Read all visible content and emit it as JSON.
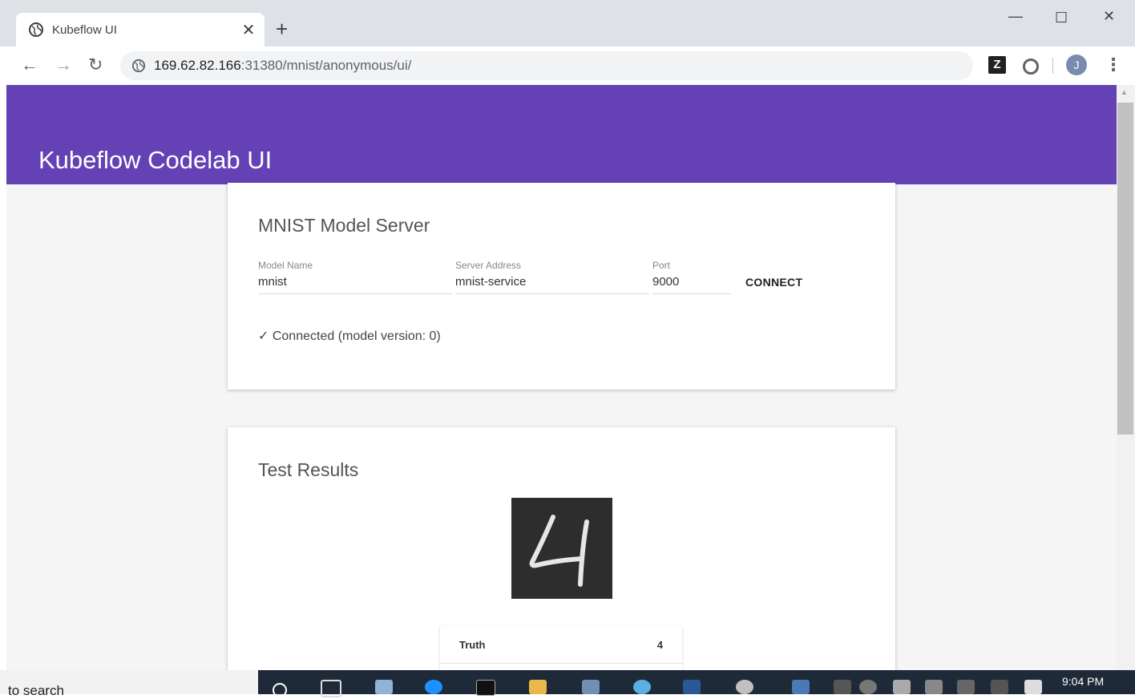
{
  "browser": {
    "tab_title": "Kubeflow UI",
    "tab_close": "✕",
    "new_tab": "+",
    "url_host": "169.62.82.166",
    "url_rest": ":31380/mnist/anonymous/ui/",
    "back": "←",
    "forward": "→",
    "reload": "↻",
    "extension_z": "Z",
    "profile_initial": "J",
    "menu": "⋮",
    "minimize": "—",
    "maximize": "☐",
    "close": "✕"
  },
  "app": {
    "title": "Kubeflow Codelab UI",
    "accent_color": "#6441b5"
  },
  "server_card": {
    "title": "MNIST Model Server",
    "model_name_label": "Model Name",
    "model_name_value": "mnist",
    "server_address_label": "Server Address",
    "server_address_value": "mnist-service",
    "port_label": "Port",
    "port_value": "9000",
    "connect_label": "CONNECT",
    "status": "✓ Connected (model version: 0)"
  },
  "results_card": {
    "title": "Test Results",
    "digit_image": "handwritten digit 4",
    "rows": [
      {
        "label": "Truth",
        "value": "4"
      }
    ]
  },
  "taskbar": {
    "search_text": "to search",
    "time": "9:04 PM"
  }
}
